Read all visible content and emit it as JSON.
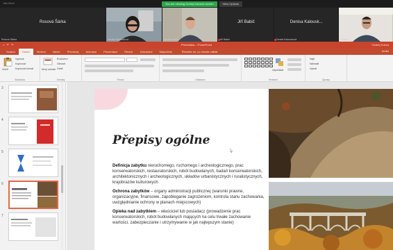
{
  "meeting": {
    "top_label": "Jitsi Meet",
    "share_banner": "You are viewing Ondrej Kobza's screen",
    "view_options": "View Options",
    "participants": [
      {
        "name": "Rosová Šárka",
        "foot": "Rosová Šárka",
        "type": "name-only"
      },
      {
        "name": "",
        "foot": "Jarmila Malaníková",
        "type": "video-woman"
      },
      {
        "name": "",
        "foot": "Jaroslav Šrám",
        "type": "video-man"
      },
      {
        "name": "Jiří Babič",
        "foot": "Jiří Babič",
        "type": "name-only"
      },
      {
        "name": "Denisa Kalousk...",
        "foot": "Denisa Kalousková",
        "type": "name-only"
      },
      {
        "name": "",
        "foot": "Ondrej",
        "type": "video-man2"
      }
    ]
  },
  "ppt": {
    "title": "Přednáška – PowerPoint",
    "account": "Ondrej Kobza",
    "quick_access": "⌂ ↶ ↷",
    "tabs": [
      "Soubor",
      "Domů",
      "Vložení",
      "Návrh",
      "Přechody",
      "Animace",
      "Prezentace",
      "Revize",
      "Zobrazení",
      "Nápověda"
    ],
    "active_tab": "Domů",
    "tell_me": "Řekněte mi, co chcete udělat",
    "share": "Sdílet",
    "ribbon": {
      "paste": "Vložit",
      "cut": "Vyjmout",
      "copy": "Kopírovat",
      "format_painter": "Kopírovat formát",
      "clipboard": "Schránka",
      "new_slide": "Nový snímek",
      "layout": "Rozložení",
      "reset": "Obnovit",
      "section": "Oddíl",
      "slides": "Snímky",
      "font": "Písmo",
      "paragraph": "Odstavec",
      "drawing": "Kreslení",
      "arrange": "Uspořádat",
      "find": "Najít",
      "replace": "Nahradit",
      "select": "Vybrat",
      "editing": "Úpravy"
    },
    "thumbnails": [
      {
        "num": "3"
      },
      {
        "num": "4"
      },
      {
        "num": "5"
      },
      {
        "num": "6"
      },
      {
        "num": "7"
      }
    ],
    "selected_thumb": "6",
    "slide": {
      "title": "Přepisy ogólne",
      "p1_term": "Definicja zabytku",
      "p1_text": " nieruchomego, ruchomego i archeologicznego, prac konserwatorskich, restauratorskich, robót budowlanych, badań konserwatorskich, architektonicznych i archeologicznych, układów urbanistycznych i ruralistycznych, krajobrazów kulturowych",
      "p2_term": "Ochrona zabytków",
      "p2_text": " – organy administracji publicznej (warunki prawne, organizacyjne, finansowe, zapobieganie zagrożeniom, kontrola stanu zachowania, uwzględnianie ochrony w planach miejscowych)",
      "p3_term": "Opieka nad zabytkiem",
      "p3_text": " – właściciel lub posiadacz (prowadzenie prac konserwatorskich, robót budowlanych mających na celu trwałe zachowanie wartości, zabezpieczanie i utrzymywanie w jak najlepszym stanie)"
    }
  }
}
